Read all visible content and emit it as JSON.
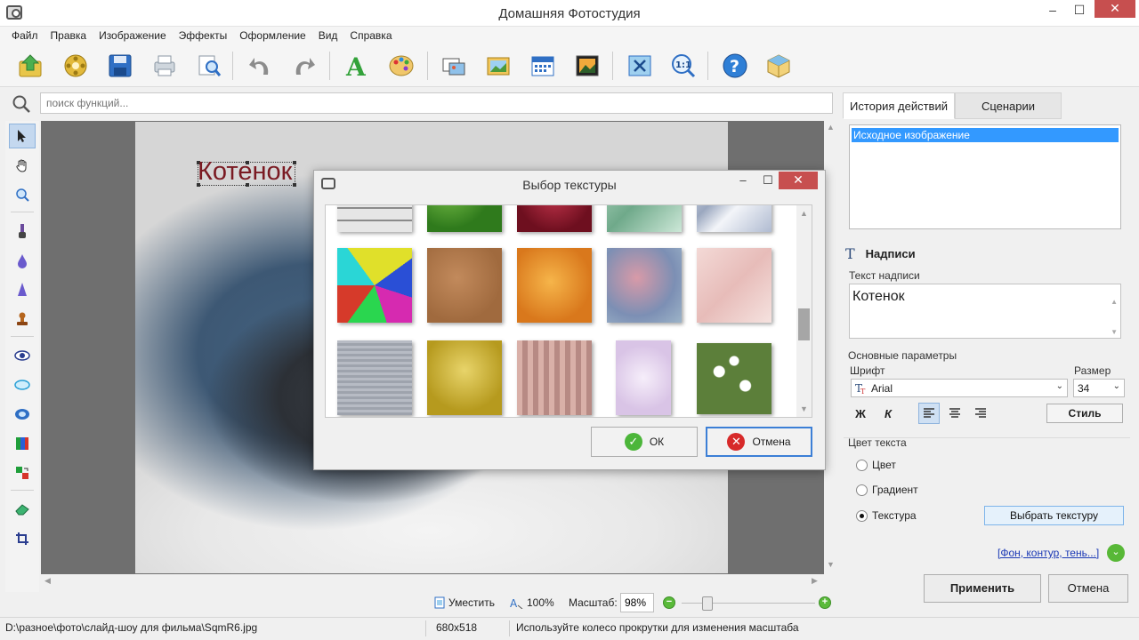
{
  "window": {
    "title": "Домашняя Фотостудия",
    "minimize": "–",
    "maximize": "☐",
    "close": "✕"
  },
  "menu": [
    "Файл",
    "Правка",
    "Изображение",
    "Эффекты",
    "Оформление",
    "Вид",
    "Справка"
  ],
  "toolbar": {
    "icons": [
      "open-icon",
      "film-icon",
      "save-icon",
      "print-icon",
      "preview-icon",
      "undo-icon",
      "redo-icon",
      "text-icon",
      "palette-icon",
      "frames-icon",
      "image-icon",
      "calendar-icon",
      "collage-icon",
      "fit-icon",
      "zoom-actual-icon",
      "help-icon",
      "box-icon"
    ]
  },
  "search": {
    "placeholder": "поиск функций..."
  },
  "left_tools": [
    "select-tool",
    "hand-tool",
    "zoom-tool",
    "brush-tool",
    "drop-tool",
    "sharpen-tool",
    "stamp-tool",
    "eye-tool",
    "ellipse-tool",
    "eye-blue-tool",
    "color-tool",
    "replace-tool",
    "eraser-tool",
    "crop-tool"
  ],
  "canvas": {
    "caption": "Котенок"
  },
  "zoombar": {
    "fit": "Уместить",
    "actual": "100%",
    "scale_label": "Масштаб:",
    "scale_value": "98%"
  },
  "status": {
    "path": "D:\\разное\\фото\\слайд-шоу для фильма\\SqmR6.jpg",
    "size": "680x518",
    "hint": "Используйте колесо прокрутки для изменения масштаба"
  },
  "right": {
    "tabs": [
      "История действий",
      "Сценарии"
    ],
    "history": [
      "Исходное изображение"
    ],
    "section_title": "Надписи",
    "text_label": "Текст надписи",
    "text_value": "Котенок",
    "basic_params": "Основные параметры",
    "font_label": "Шрифт",
    "font_value": "Arial",
    "size_label": "Размер",
    "size_value": "34",
    "bold": "Ж",
    "italic": "К",
    "style_button": "Стиль",
    "color_label": "Цвет текста",
    "radio": [
      "Цвет",
      "Градиент",
      "Текстура"
    ],
    "radio_selected": "Текстура",
    "pick_texture": "Выбрать текстуру",
    "extra_link": "[Фон, контур, тень...]",
    "apply": "Применить",
    "cancel": "Отмена"
  },
  "dialog": {
    "title": "Выбор текстуры",
    "ok": "ОК",
    "cancel": "Отмена",
    "textures": [
      "stone-blocks",
      "green-grass",
      "red-stone",
      "green-marble",
      "blue-marble",
      "multicolor-mosaic",
      "brown-cork",
      "orange-crackle",
      "blue-watercolor",
      "pink-marble",
      "gray-metal",
      "gold-foil",
      "pink-stripes",
      "lilac-tiles",
      "daisies"
    ]
  }
}
